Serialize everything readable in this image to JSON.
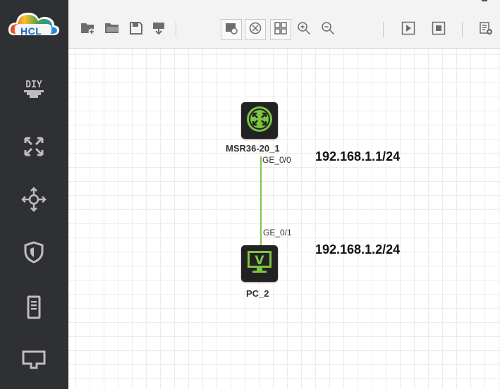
{
  "app": {
    "logo_text": "HCL"
  },
  "sidebar": {
    "items": [
      {
        "name": "diy",
        "icon": "diy-icon"
      },
      {
        "name": "router",
        "icon": "router-icon"
      },
      {
        "name": "switch",
        "icon": "switch-icon"
      },
      {
        "name": "firewall",
        "icon": "shield-icon"
      },
      {
        "name": "server",
        "icon": "server-icon"
      },
      {
        "name": "terminal",
        "icon": "monitor-icon"
      }
    ]
  },
  "toolbar": {
    "buttons": [
      "new-project",
      "open-project",
      "save",
      "export",
      "show-labels",
      "show-ports",
      "grid",
      "zoom-in",
      "zoom-out",
      "start",
      "stop",
      "settings"
    ]
  },
  "topology": {
    "devices": [
      {
        "name": "MSR36-20_1",
        "type": "router",
        "ip": "192.168.1.1/24",
        "port": "GE_0/0"
      },
      {
        "name": "PC_2",
        "type": "pc",
        "ip": "192.168.1.2/24",
        "port": "GE_0/1"
      }
    ],
    "link_color": "#8bc34a"
  },
  "colors": {
    "sidebar": "#2f3033",
    "router_accent": "#7cc441",
    "pc_accent": "#7cc441"
  }
}
